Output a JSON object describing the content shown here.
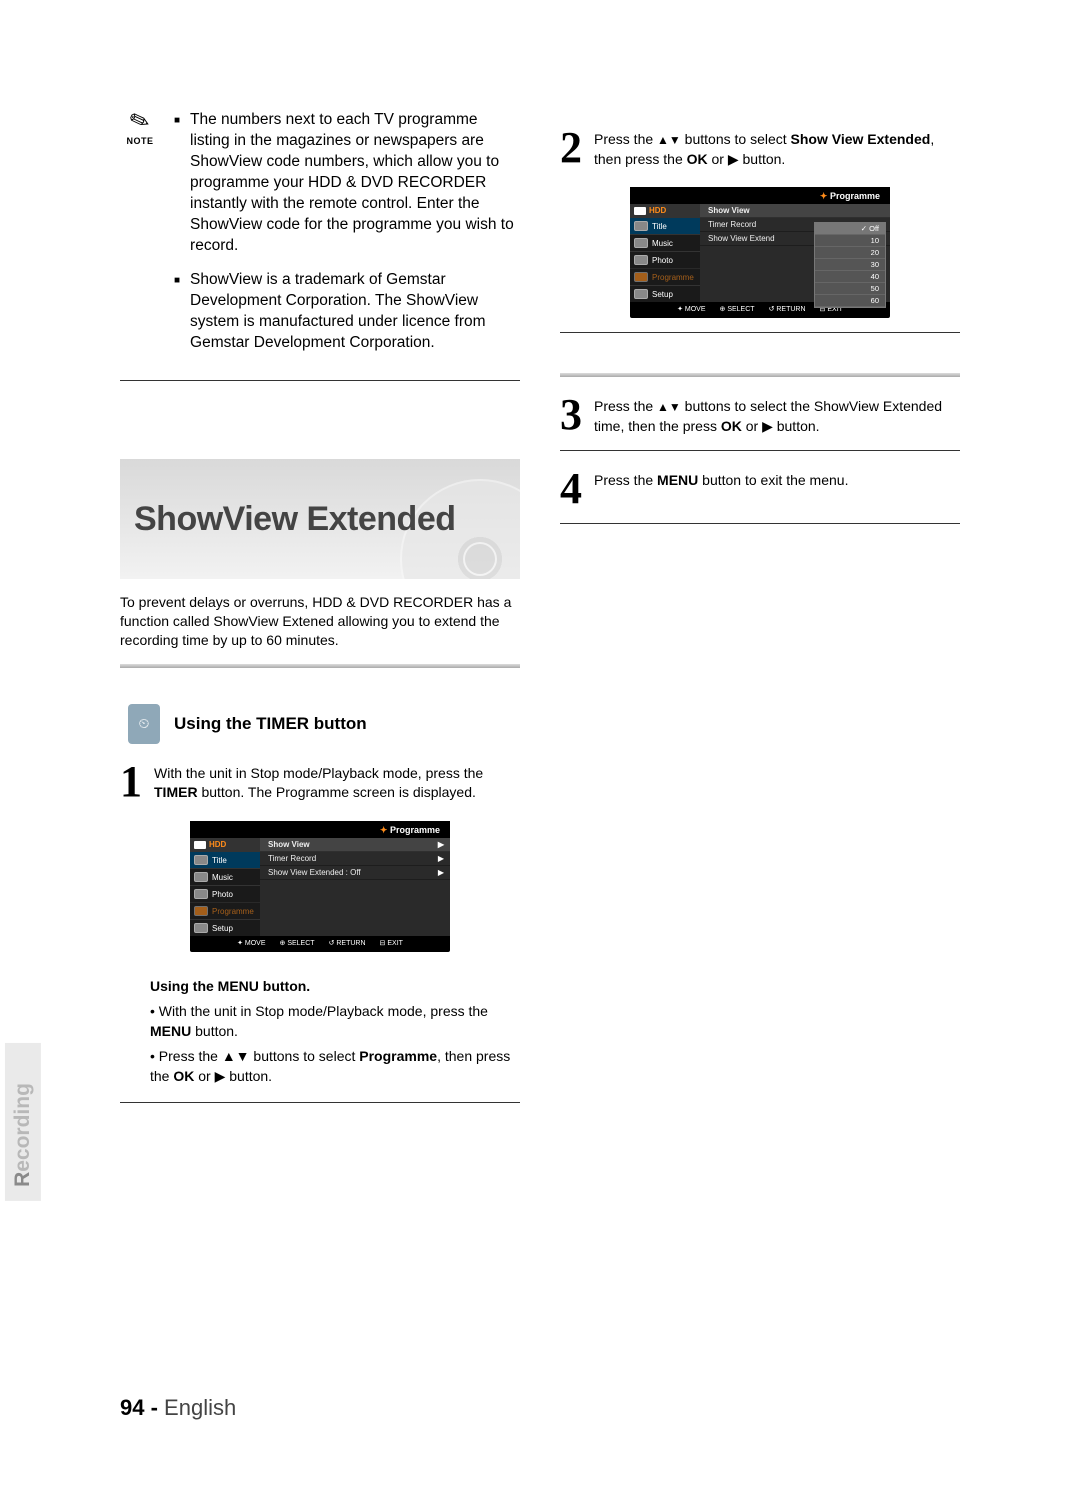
{
  "note": {
    "icon": "✎",
    "label": "NOTE",
    "bullets": [
      "The numbers next to each TV programme listing in the magazines or newspapers are ShowView code numbers, which allow you to programme your HDD & DVD RECORDER instantly with the remote control. Enter the ShowView code for the programme you wish to record.",
      "ShowView is a trademark of Gemstar Development Corporation. The ShowView system is manufactured under licence from Gemstar Development Corporation."
    ]
  },
  "feature": {
    "title": "ShowView Extended",
    "intro": "To prevent delays or overruns, HDD & DVD RECORDER has a function called ShowView Extened allowing you to extend the recording time by up to 60 minutes."
  },
  "section": {
    "icon_label": "⏲",
    "title": "Using the TIMER button"
  },
  "steps": {
    "s1": {
      "num": "1",
      "pre": "With the unit in Stop mode/Playback mode, press the ",
      "bold": "TIMER",
      "post": " button. The Programme screen is displayed."
    },
    "s2": {
      "num": "2",
      "pre": "Press the ",
      "arrows": "▲▼",
      "mid": " buttons to select ",
      "bold": "Show View Extended",
      "post1": ", then press the ",
      "bold2": "OK",
      "post2": " or ▶ button."
    },
    "s3": {
      "num": "3",
      "pre": "Press the ",
      "arrows": "▲▼",
      "mid": " buttons to select the ShowView Extended time, then the press ",
      "bold": "OK",
      "post": " or ▶ button."
    },
    "s4": {
      "num": "4",
      "pre": "Press the ",
      "bold": "MENU",
      "post": " button to exit the menu."
    }
  },
  "menu_sub": {
    "heading": "Using the MENU button.",
    "items": [
      {
        "pre": "• With the unit in Stop mode/Playback mode, press the ",
        "bold": "MENU",
        "post": " button."
      },
      {
        "pre": "• Press the ▲▼ buttons to select ",
        "bold": "Programme",
        "post": ", then press the ",
        "bold2": "OK",
        "post2": " or ▶ button."
      }
    ]
  },
  "osd1": {
    "header": "Programme",
    "hdd": "HDD",
    "tabs": [
      "Title",
      "Music",
      "Photo",
      "Programme",
      "Setup"
    ],
    "rows": [
      {
        "l": "Show View",
        "r": "▶"
      },
      {
        "l": "Timer Record",
        "r": "▶"
      },
      {
        "l": "Show View Extended  : Off",
        "r": "▶"
      }
    ],
    "footer": [
      "✦ MOVE",
      "⊕ SELECT",
      "↺ RETURN",
      "⊟ EXIT"
    ]
  },
  "osd2": {
    "header": "Programme",
    "hdd": "HDD",
    "tabs": [
      "Title",
      "Music",
      "Photo",
      "Programme",
      "Setup"
    ],
    "rows": [
      {
        "l": "Show View",
        "r": ""
      },
      {
        "l": "Timer Record",
        "r": ""
      },
      {
        "l": "Show View Extend",
        "r": ""
      }
    ],
    "submenu": [
      "Off",
      "10",
      "20",
      "30",
      "40",
      "50",
      "60"
    ],
    "footer": [
      "✦ MOVE",
      "⊕ SELECT",
      "↺ RETURN",
      "⊟ EXIT"
    ]
  },
  "side_label": {
    "accent": "R",
    "rest": "ecording"
  },
  "footer": {
    "num": "94 -",
    "lang": "English"
  }
}
